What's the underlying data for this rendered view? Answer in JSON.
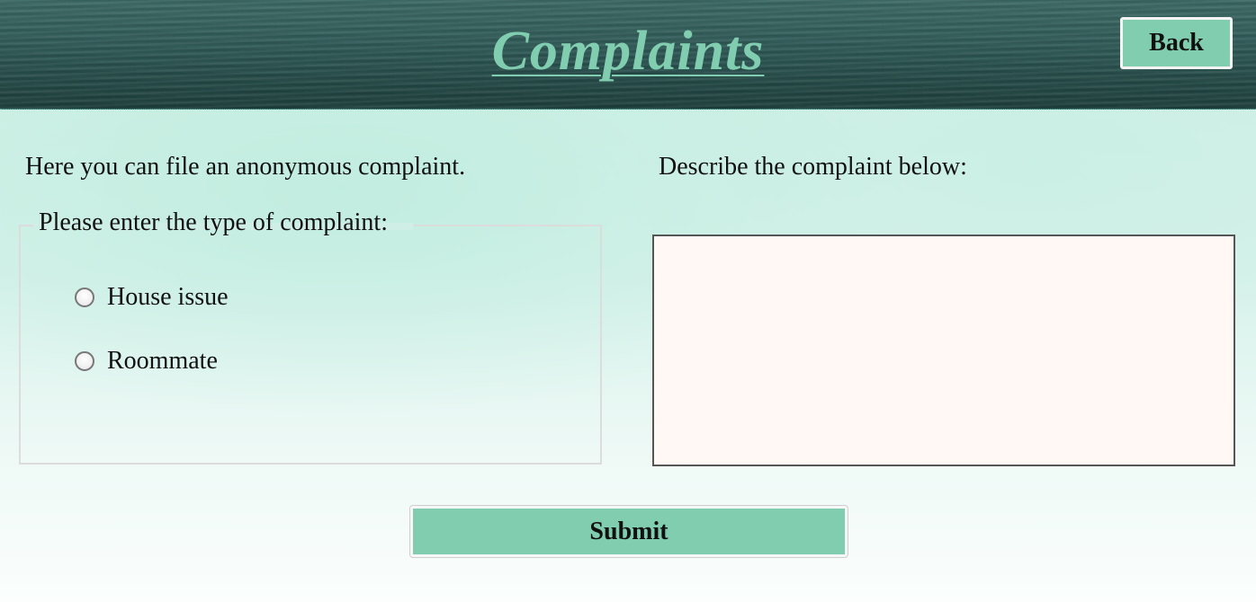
{
  "header": {
    "title": "Complaints",
    "back_label": "Back"
  },
  "intro": {
    "text": "Here you can file an anonymous complaint."
  },
  "complaint_type": {
    "legend": "Please enter the type of complaint:",
    "options": [
      {
        "label": "House issue",
        "checked": false
      },
      {
        "label": "Roommate",
        "checked": false
      }
    ]
  },
  "description": {
    "label": "Describe the complaint below:",
    "value": ""
  },
  "submit": {
    "label": "Submit"
  },
  "colors": {
    "accent": "#80cdb0",
    "header_bg": "#2f5a57",
    "textarea_bg": "#fff8f4"
  }
}
